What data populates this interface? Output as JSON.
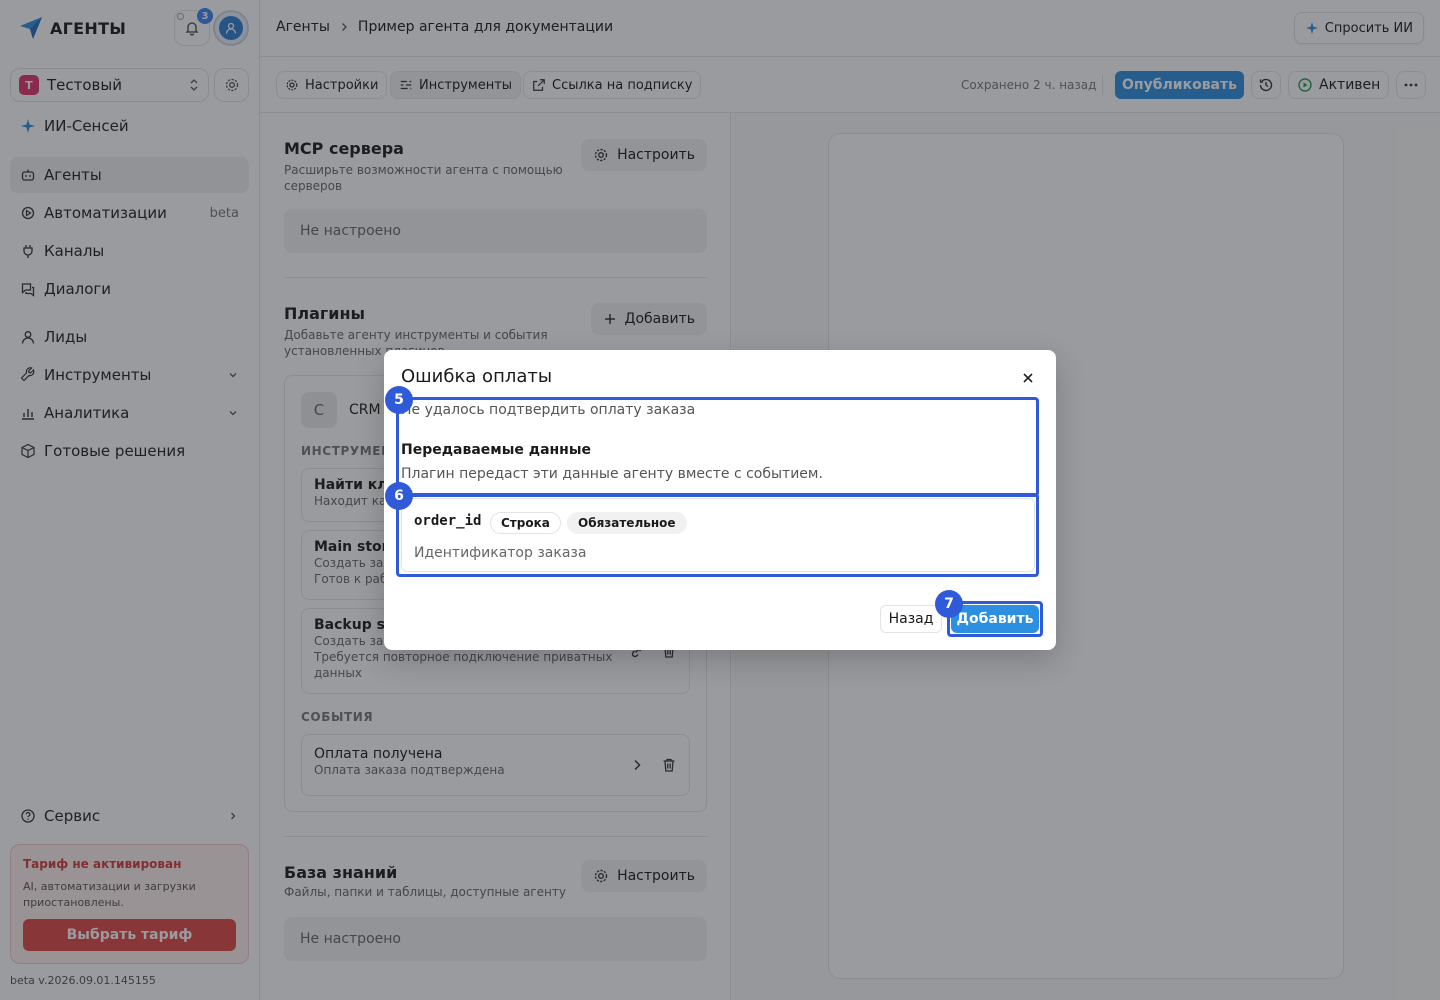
{
  "brand": {
    "name": "АГЕНТЫ"
  },
  "notifications": {
    "count": "3"
  },
  "workspace": {
    "badge": "Т",
    "name": "Тестовый"
  },
  "sidebar": {
    "top_item": "ИИ-Сенсей",
    "items": [
      {
        "label": "Агенты",
        "extra": ""
      },
      {
        "label": "Автоматизации",
        "extra": "beta"
      },
      {
        "label": "Каналы",
        "extra": ""
      },
      {
        "label": "Диалоги",
        "extra": ""
      },
      {
        "label": "Лиды",
        "extra": ""
      },
      {
        "label": "Инструменты",
        "extra": ""
      },
      {
        "label": "Аналитика",
        "extra": ""
      },
      {
        "label": "Готовые решения",
        "extra": ""
      }
    ],
    "service": "Сервис"
  },
  "tariff": {
    "title": "Тариф не активирован",
    "text": "AI, автоматизации и загрузки приостановлены.",
    "button": "Выбрать тариф"
  },
  "version": "beta v.2026.09.01.145155",
  "breadcrumb": {
    "root": "Агенты",
    "current": "Пример агента для документации"
  },
  "ask_ai": "Спросить ИИ",
  "toolbar": {
    "settings": "Настройки",
    "tools": "Инструменты",
    "subscription_link": "Ссылка на подписку",
    "saved": "Сохранено 2 ч. назад",
    "publish": "Опубликовать",
    "status": "Активен"
  },
  "mcp": {
    "title": "MCP сервера",
    "subtitle": "Расширьте возможности агента с помощью серверов",
    "action": "Настроить",
    "empty": "Не настроено"
  },
  "plugins": {
    "title": "Плагины",
    "subtitle": "Добавьте агенту инструменты и события установленных плагинов",
    "action": "Добавить",
    "card": {
      "logo": "C",
      "name": "CRM",
      "tools_label": "ИНСТРУМЕН",
      "tools": [
        {
          "name": "Найти кли",
          "desc": "Находит кар"
        },
        {
          "name": "Main store",
          "desc": "Создать зак",
          "desc2": "Готов к раб"
        },
        {
          "name": "Backup st",
          "desc": "Создать зак",
          "desc2": "Требуется повторное подключение приватных",
          "desc3": "данных"
        }
      ],
      "events_label": "СОБЫТИЯ",
      "events": [
        {
          "name": "Оплата получена",
          "desc": "Оплата заказа подтверждена"
        }
      ]
    }
  },
  "knowledge": {
    "title": "База знаний",
    "subtitle": "Файлы, папки и таблицы, доступные агенту",
    "action": "Настроить",
    "empty": "Не настроено"
  },
  "dialog": {
    "title": "Ошибка оплаты",
    "description": "Не удалось подтвердить оплату заказа",
    "section_title": "Передаваемые данные",
    "section_subtitle": "Плагин передаст эти данные агенту вместе с событием.",
    "param": {
      "name": "order_id",
      "type": "Строка",
      "required": "Обязательное",
      "description": "Идентификатор заказа"
    },
    "back": "Назад",
    "add": "Добавить"
  },
  "highlights": {
    "h5": "5",
    "h6": "6",
    "h7": "7"
  },
  "colors": {
    "primary": "#2d8fe0",
    "highlight": "#2f5bd8",
    "danger": "#e04848"
  }
}
